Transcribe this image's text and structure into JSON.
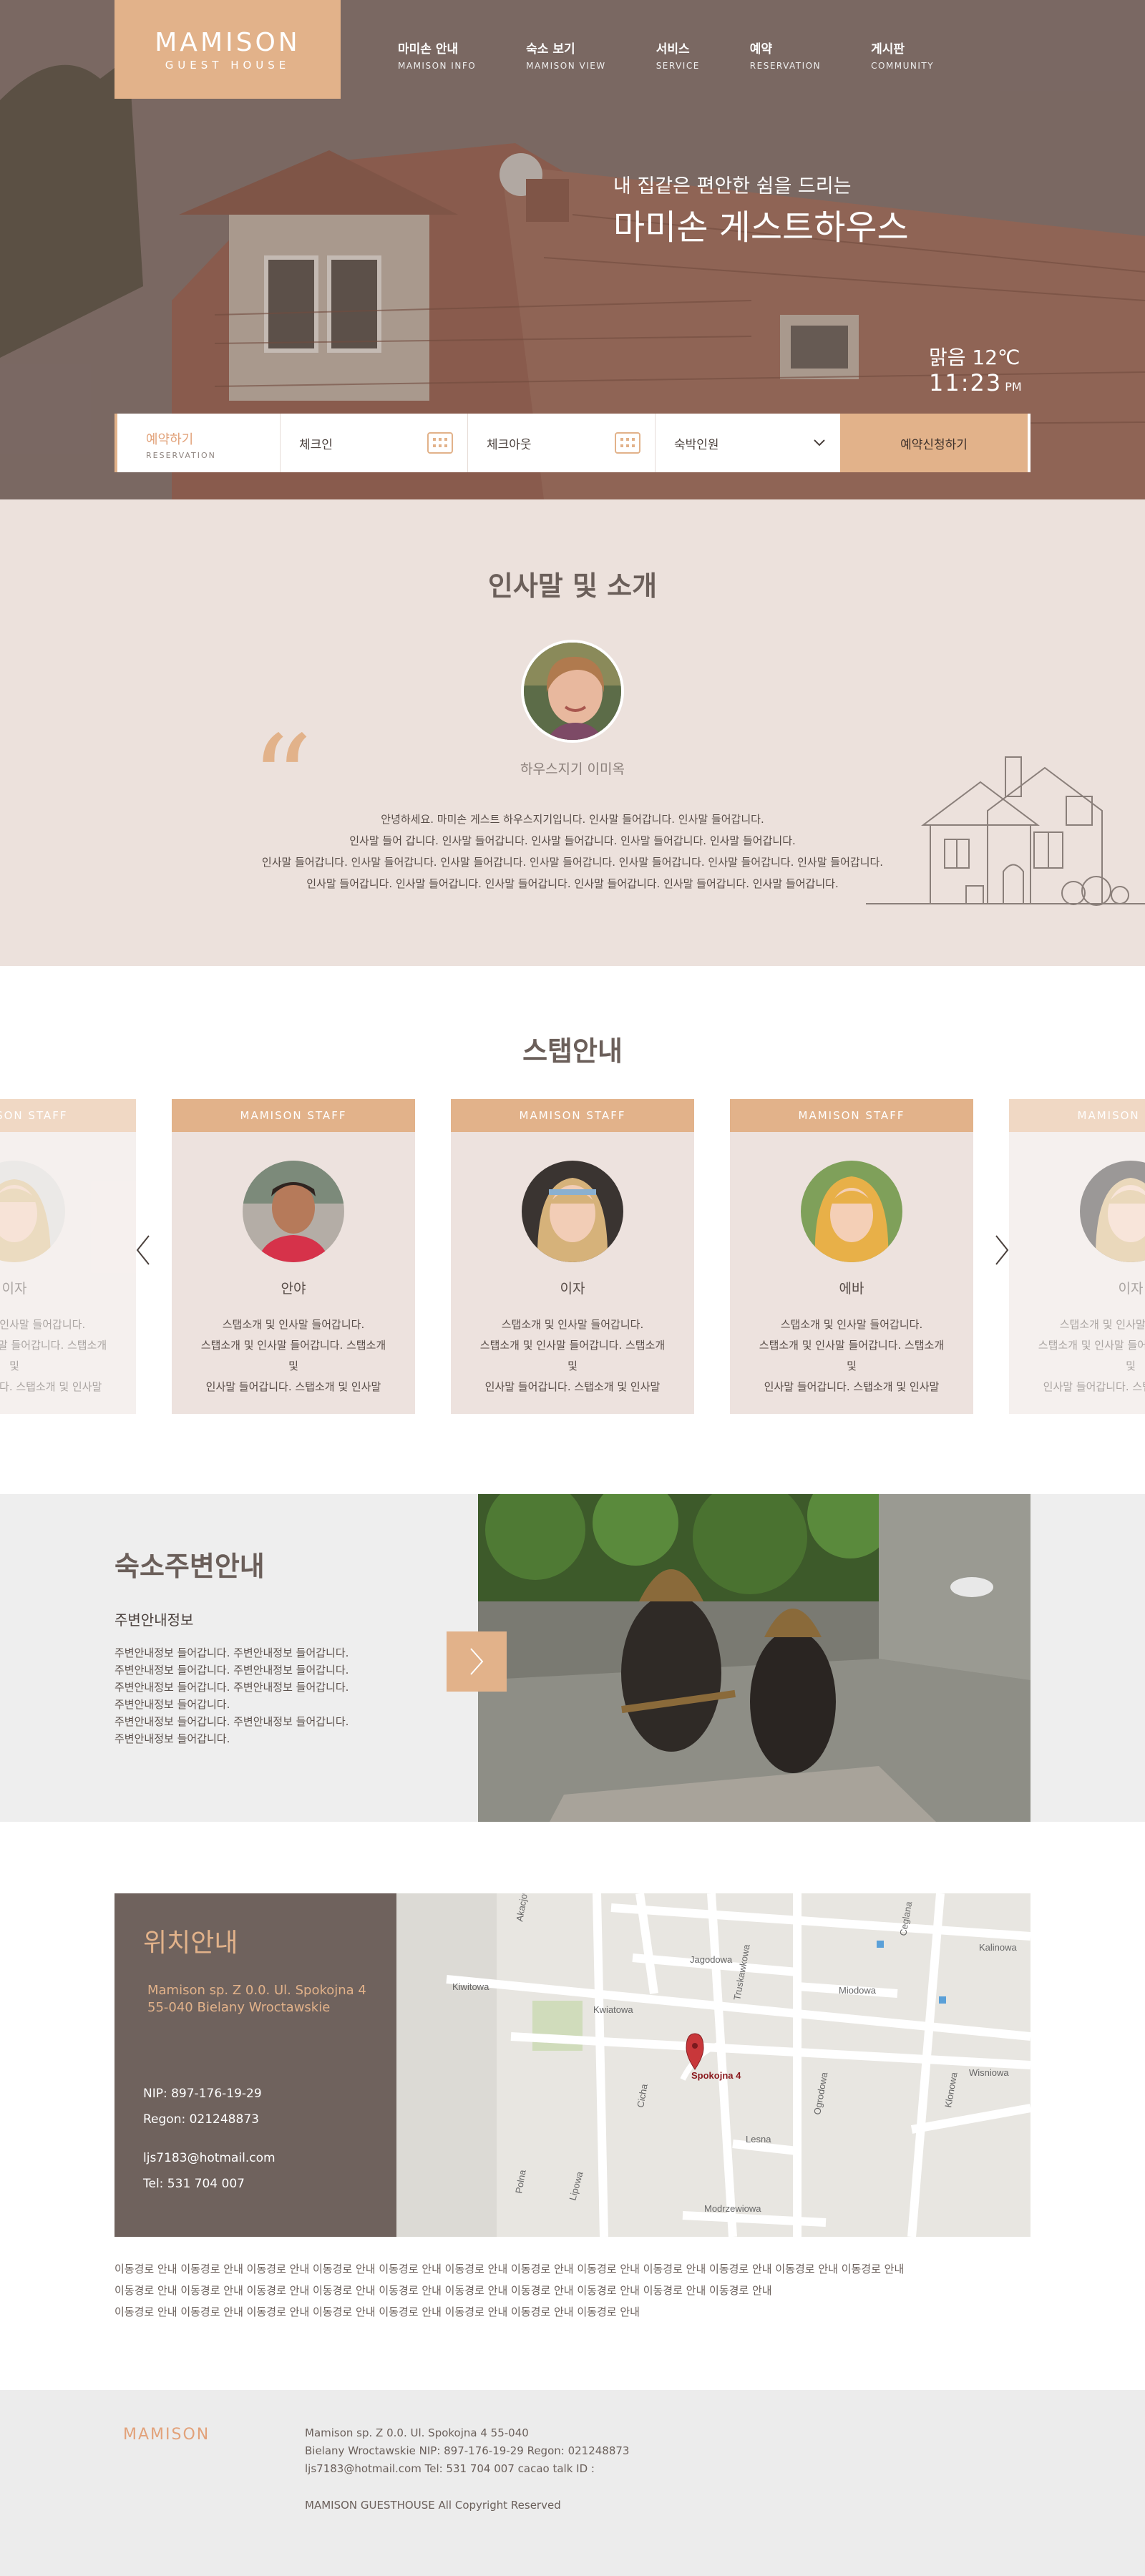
{
  "brand": {
    "name": "MAMISON",
    "subtitle": "GUEST HOUSE"
  },
  "nav": [
    {
      "ko": "마미손 안내",
      "en": "MAMISON INFO"
    },
    {
      "ko": "숙소 보기",
      "en": "MAMISON VIEW"
    },
    {
      "ko": "서비스",
      "en": "SERVICE"
    },
    {
      "ko": "예약",
      "en": "RESERVATION"
    },
    {
      "ko": "게시판",
      "en": "COMMUNITY"
    }
  ],
  "hero": {
    "subtitle": "내 집같은 편안한 쉼을 드리는",
    "title": "마미손 게스트하우스",
    "weather": "맑음 12℃",
    "time": "11:23",
    "ampm": "PM"
  },
  "booking": {
    "label_ko": "예약하기",
    "label_en": "RESERVATION",
    "checkin": "체크인",
    "checkout": "체크아웃",
    "guests": "숙박인원",
    "submit": "예약신청하기"
  },
  "greeting": {
    "title": "인사말 및 소개",
    "name": "하우스지기 이미옥",
    "lines": [
      "안녕하세요. 마미손 게스트 하우스지기입니다. 인사말 들어갑니다. 인사말 들어갑니다.",
      "인사말 들어 갑니다. 인사말 들어갑니다. 인사말 들어갑니다. 인사말 들어갑니다. 인사말 들어갑니다.",
      "인사말 들어갑니다. 인사말 들어갑니다. 인사말 들어갑니다. 인사말 들어갑니다. 인사말 들어갑니다. 인사말 들어갑니다. 인사말 들어갑니다.",
      "인사말 들어갑니다. 인사말 들어갑니다. 인사말 들어갑니다. 인사말 들어갑니다. 인사말 들어갑니다. 인사말 들어갑니다."
    ]
  },
  "staff": {
    "title": "스탭안내",
    "header": "MAMISON STAFF",
    "members": [
      {
        "name": "이자",
        "desc": [
          "스탭소개 및 인사말 들어갑니다.",
          "스탭소개 및 인사말 들어갑니다. 스탭소개 및",
          "인사말 들어갑니다. 스탭소개 및 인사말"
        ]
      },
      {
        "name": "안야",
        "desc": [
          "스탭소개 및 인사말 들어갑니다.",
          "스탭소개 및 인사말 들어갑니다. 스탭소개 및",
          "인사말 들어갑니다. 스탭소개 및 인사말"
        ]
      },
      {
        "name": "이자",
        "desc": [
          "스탭소개 및 인사말 들어갑니다.",
          "스탭소개 및 인사말 들어갑니다. 스탭소개 및",
          "인사말 들어갑니다. 스탭소개 및 인사말"
        ]
      },
      {
        "name": "에바",
        "desc": [
          "스탭소개 및 인사말 들어갑니다.",
          "스탭소개 및 인사말 들어갑니다. 스탭소개 및",
          "인사말 들어갑니다. 스탭소개 및 인사말"
        ]
      },
      {
        "name": "이자",
        "desc": [
          "스탭소개 및 인사말 들어갑니다.",
          "스탭소개 및 인사말 들어갑니다. 스탭소개 및",
          "인사말 들어갑니다. 스탭소개 및 인사말"
        ]
      }
    ]
  },
  "around": {
    "title": "숙소주변안내",
    "subtitle": "주변안내정보",
    "lines": [
      "주변안내정보 들어갑니다. 주변안내정보 들어갑니다.",
      "주변안내정보 들어갑니다. 주변안내정보 들어갑니다.",
      "주변안내정보 들어갑니다. 주변안내정보 들어갑니다.",
      "주변안내정보 들어갑니다.",
      "주변안내정보 들어갑니다. 주변안내정보 들어갑니다.",
      "주변안내정보 들어갑니다."
    ]
  },
  "location": {
    "title": "위치안내",
    "address1": "Mamison sp. Z 0.0. Ul. Spokojna 4",
    "address2": "55-040 Bielany Wroctawskie",
    "nip": "NIP: 897-176-19-29",
    "regon": "Regon: 021248873",
    "email": "ljs7183@hotmail.com",
    "tel": "Tel: 531 704 007",
    "map_marker": "Spokojna 4",
    "map_streets": [
      "Kiwitowa",
      "Kalinowa",
      "Jagodowa",
      "Truskawkowa",
      "Miodowa",
      "Kwiatowa",
      "Wisniowa",
      "Klonowa",
      "Ogrodowa",
      "Cicha",
      "Lesna",
      "Modrzewiowa",
      "Lipowa",
      "Polna",
      "Ceglana",
      "Akacjowa"
    ],
    "directions": [
      "이동경로 안내 이동경로 안내 이동경로 안내 이동경로 안내 이동경로 안내 이동경로 안내 이동경로 안내 이동경로 안내 이동경로 안내 이동경로 안내 이동경로 안내 이동경로 안내",
      "이동경로 안내 이동경로 안내 이동경로 안내 이동경로 안내 이동경로 안내 이동경로 안내 이동경로 안내 이동경로 안내 이동경로 안내 이동경로 안내",
      "이동경로 안내 이동경로 안내 이동경로 안내 이동경로 안내 이동경로 안내 이동경로 안내 이동경로 안내 이동경로 안내"
    ]
  },
  "footer": {
    "logo": "MAMISON",
    "line1": "Mamison sp. Z 0.0. Ul. Spokojna 4     55-040",
    "line2": "Bielany Wroctawskie  NIP: 897-176-19-29    Regon: 021248873",
    "line3": "ljs7183@hotmail.com      Tel: 531 704 007     cacao talk ID :",
    "copyright": "MAMISON GUESTHOUSE All Copyright Reserved"
  },
  "colors": {
    "accent": "#e2b28a",
    "greet_bg": "#ece1dc",
    "panel": "#6f625d",
    "footer_bg": "#ececec"
  },
  "icons": [
    "calendar-icon",
    "chevron-down-icon",
    "quote-icon",
    "house-illustration",
    "arrow-left-icon",
    "arrow-right-icon",
    "map-pin-icon"
  ]
}
